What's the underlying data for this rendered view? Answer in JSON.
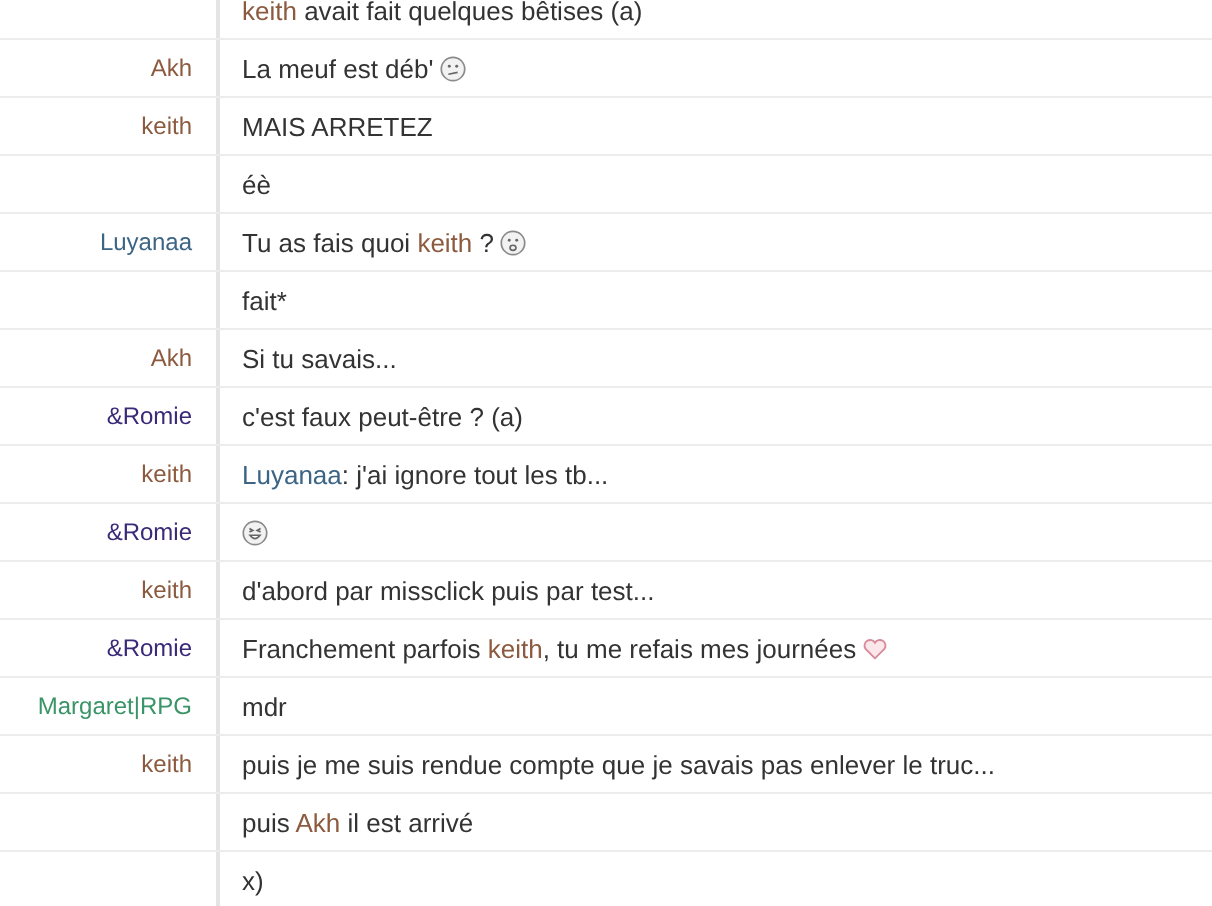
{
  "messages": [
    {
      "parts": [
        {
          "kind": "mention",
          "text": "keith",
          "color": "#8c5a3f"
        },
        {
          "kind": "text",
          "text": " avait fait quelques bêtises (a)"
        }
      ]
    },
    {
      "author": {
        "name": "Akh",
        "color": "#8c5a3f"
      },
      "parts": [
        {
          "kind": "text",
          "text": "La meuf est déb'"
        },
        {
          "kind": "confused"
        }
      ]
    },
    {
      "author": {
        "name": "keith",
        "color": "#8c5a3f"
      },
      "parts": [
        {
          "kind": "text",
          "text": "MAIS ARRETEZ"
        }
      ]
    },
    {
      "parts": [
        {
          "kind": "text",
          "text": "éè"
        }
      ]
    },
    {
      "author": {
        "name": "Luyanaa",
        "color": "#3c6585"
      },
      "parts": [
        {
          "kind": "text",
          "text": "Tu as fais quoi "
        },
        {
          "kind": "mention",
          "text": "keith",
          "color": "#8c5a3f"
        },
        {
          "kind": "text",
          "text": " ?"
        },
        {
          "kind": "sad"
        }
      ]
    },
    {
      "parts": [
        {
          "kind": "text",
          "text": "fait*"
        }
      ]
    },
    {
      "author": {
        "name": "Akh",
        "color": "#8c5a3f"
      },
      "parts": [
        {
          "kind": "text",
          "text": "Si tu savais..."
        }
      ]
    },
    {
      "author": {
        "name": "&Romie",
        "color": "#3a2a78"
      },
      "parts": [
        {
          "kind": "text",
          "text": "c'est faux peut-être ? (a)"
        }
      ]
    },
    {
      "author": {
        "name": "keith",
        "color": "#8c5a3f"
      },
      "parts": [
        {
          "kind": "mention",
          "text": "Luyanaa",
          "color": "#3c6585"
        },
        {
          "kind": "text",
          "text": ": j'ai ignore tout les tb..."
        }
      ]
    },
    {
      "author": {
        "name": "&Romie",
        "color": "#3a2a78"
      },
      "parts": [
        {
          "kind": "grin"
        }
      ]
    },
    {
      "author": {
        "name": "keith",
        "color": "#8c5a3f"
      },
      "parts": [
        {
          "kind": "text",
          "text": "d'abord par missclick puis par test..."
        }
      ]
    },
    {
      "author": {
        "name": "&Romie",
        "color": "#3a2a78"
      },
      "parts": [
        {
          "kind": "text",
          "text": "Franchement parfois "
        },
        {
          "kind": "mention",
          "text": "keith",
          "color": "#8c5a3f"
        },
        {
          "kind": "text",
          "text": ", tu me refais mes journées"
        },
        {
          "kind": "heart"
        }
      ]
    },
    {
      "author": {
        "name": "Margaret|RPG",
        "color": "#3a9468"
      },
      "parts": [
        {
          "kind": "text",
          "text": "mdr"
        }
      ]
    },
    {
      "author": {
        "name": "keith",
        "color": "#8c5a3f"
      },
      "parts": [
        {
          "kind": "text",
          "text": "puis je me suis rendue compte que je savais pas enlever le truc..."
        }
      ]
    },
    {
      "parts": [
        {
          "kind": "text",
          "text": "puis "
        },
        {
          "kind": "mention",
          "text": "Akh",
          "color": "#8c5a3f"
        },
        {
          "kind": "text",
          "text": " il est arrivé"
        }
      ]
    },
    {
      "parts": [
        {
          "kind": "text",
          "text": "x)"
        }
      ]
    }
  ]
}
